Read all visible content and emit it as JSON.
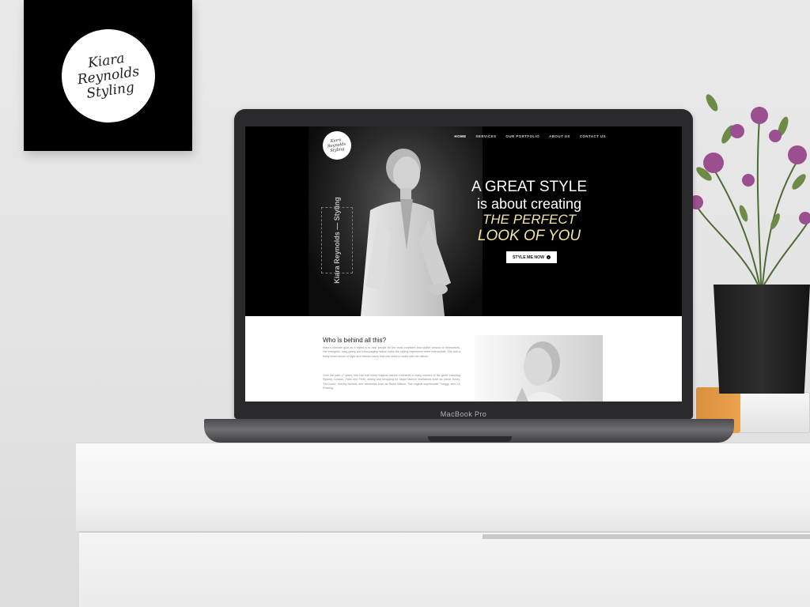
{
  "wall_logo": {
    "lines": [
      "Kiara",
      "Reynolds",
      "Styling"
    ]
  },
  "laptop": {
    "brand_label": "MacBook Pro"
  },
  "site": {
    "logo_lines": [
      "Kiara",
      "Reynolds",
      "Styling"
    ],
    "nav": [
      {
        "label": "HOME",
        "active": true
      },
      {
        "label": "SERVICES",
        "active": false
      },
      {
        "label": "OUR PORTFOLIO",
        "active": false
      },
      {
        "label": "ABOUT US",
        "active": false
      },
      {
        "label": "CONTACT US",
        "active": false
      }
    ],
    "vertical_name": "Kiara Reynolds — Styling",
    "hero": {
      "line1": "A GREAT STYLE",
      "line2": "is about creating",
      "line3": "THE PERFECT",
      "line4": "LOOK OF YOU",
      "cta_label": "STYLE ME NOW"
    },
    "about": {
      "title": "Who is behind all this?",
      "paragraph1": "Kiara's ultimate goal as a stylist is to help people be the most confident and stylish version of themselves. Her energetic, easy-going and encouraging nature make the styling experience more memorable. She has a finely tuned sense of style and fashion savvy that she loves to share with her clients.",
      "paragraph2": "Over the past 17 years, she has had many magical fashion moments in many corners of the globe including Sydney, London, Paris and Perth, styling and shopping for Major fashion institutions such as David Jones, The Iconic, Harvey Nichols, and celebrities such as Rebel Wilson, \"the original supermodel\" Twiggy, and J.K Rowling."
    }
  },
  "colors": {
    "accent_yellow": "#f2e6a0",
    "hero_bg": "#000000",
    "pot": "#1f1f1f",
    "flowers": "#9b4f8e",
    "book_orange": "#e39a45"
  }
}
